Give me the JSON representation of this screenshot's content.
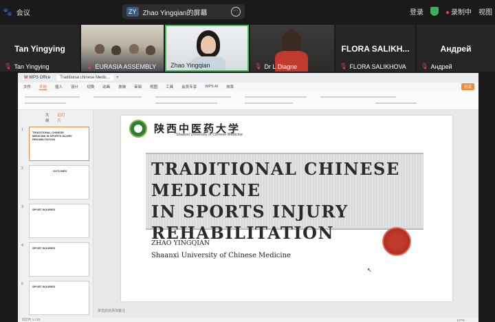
{
  "topbar": {
    "meeting_label": "会议",
    "share_badge": "ZY",
    "share_title": "Zhao Yingqian的屏幕",
    "login_label": "登录",
    "recording_label": "录制中",
    "view_label": "视图"
  },
  "participants": [
    {
      "big_name": "Tan Yingying",
      "label": "Tan Yingying",
      "type": "name"
    },
    {
      "big_name": "",
      "label": "EURASIA ASSEMBLY",
      "type": "video"
    },
    {
      "big_name": "",
      "label": "Zhao Yingqian",
      "type": "video-active"
    },
    {
      "big_name": "",
      "label": "Dr L Diagne",
      "type": "video"
    },
    {
      "big_name": "FLORA  SALIKH...",
      "label": "FLORA SALIKHOVA",
      "type": "name"
    },
    {
      "big_name": "Андрей",
      "label": "Андрей",
      "type": "name"
    }
  ],
  "wps": {
    "app_tab": "WPS Office",
    "doc_tab": "Traditional chinese Medic...",
    "menu": [
      "文件",
      "开始",
      "插入",
      "设计",
      "切换",
      "动画",
      "放映",
      "审阅",
      "视图",
      "工具",
      "会员专享",
      "WPS AI",
      "效率"
    ],
    "active_menu": "开始",
    "share_button": "分享",
    "panel_tabs": [
      "大纲",
      "幻灯片"
    ],
    "slide_numbers": [
      "1",
      "2",
      "3",
      "4",
      "5"
    ],
    "thumbnails": [
      {
        "title": "TRADITIONAL CHINESE MEDICINE IN SPORTS INJURY REHABILITATION"
      },
      {
        "title": "OUTLINES"
      },
      {
        "title": "SPORT INJURIES"
      },
      {
        "title": "SPORT INJURIES"
      },
      {
        "title": "SPORT INJURIES"
      }
    ],
    "notes_placeholder": "单击此处添加备注",
    "status_left": "幻灯片 1 / 23",
    "status_zoom": "107%"
  },
  "slide": {
    "university_cn": "陕西中医药大学",
    "university_en": "Shaanxi University of Chinese Medicine",
    "title": "TRADITIONAL CHINESE MEDICINE\nIN SPORTS INJURY\nREHABILITATION",
    "author": "ZHAO YINGQIAN",
    "affiliation": "Shaanxi University of Chinese Medicine"
  }
}
